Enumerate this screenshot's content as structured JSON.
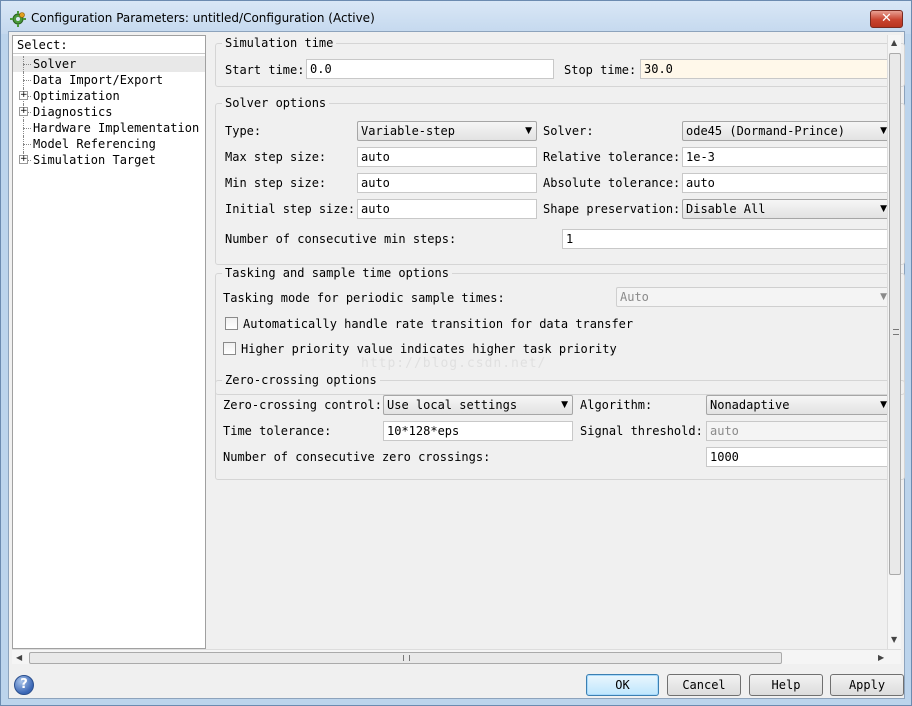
{
  "window": {
    "title": "Configuration Parameters: untitled/Configuration (Active)",
    "app_icon": "simulink-gear-icon",
    "close_glyph": "✕"
  },
  "tree": {
    "header": "Select:",
    "items": [
      {
        "label": "Solver",
        "expandable": false,
        "selected": true
      },
      {
        "label": "Data Import/Export",
        "expandable": false,
        "selected": false
      },
      {
        "label": "Optimization",
        "expandable": true,
        "selected": false
      },
      {
        "label": "Diagnostics",
        "expandable": true,
        "selected": false
      },
      {
        "label": "Hardware Implementation",
        "expandable": false,
        "selected": false
      },
      {
        "label": "Model Referencing",
        "expandable": false,
        "selected": false
      },
      {
        "label": "Simulation Target",
        "expandable": true,
        "selected": false
      }
    ]
  },
  "simulation_time": {
    "title": "Simulation time",
    "start_label": "Start time:",
    "start_value": "0.0",
    "stop_label": "Stop time:",
    "stop_value": "30.0"
  },
  "solver_options": {
    "title": "Solver options",
    "type_label": "Type:",
    "type_value": "Variable-step",
    "solver_label": "Solver:",
    "solver_value": "ode45 (Dormand-Prince)",
    "max_step_label": "Max step size:",
    "max_step_value": "auto",
    "rel_tol_label": "Relative tolerance:",
    "rel_tol_value": "1e-3",
    "min_step_label": "Min step size:",
    "min_step_value": "auto",
    "abs_tol_label": "Absolute tolerance:",
    "abs_tol_value": "auto",
    "init_step_label": "Initial step size:",
    "init_step_value": "auto",
    "shape_label": "Shape preservation:",
    "shape_value": "Disable All",
    "consec_min_label": "Number of consecutive min steps:",
    "consec_min_value": "1"
  },
  "tasking": {
    "title": "Tasking and sample time options",
    "mode_label": "Tasking mode for periodic sample times:",
    "mode_value": "Auto",
    "auto_rate_label": "Automatically handle rate transition for data transfer",
    "auto_rate_checked": false,
    "priority_label": "Higher priority value indicates higher task priority",
    "priority_checked": false
  },
  "zero_crossing": {
    "title": "Zero-crossing options",
    "control_label": "Zero-crossing control:",
    "control_value": "Use local settings",
    "algorithm_label": "Algorithm:",
    "algorithm_value": "Nonadaptive",
    "time_tol_label": "Time tolerance:",
    "time_tol_value": "10*128*eps",
    "signal_thr_label": "Signal threshold:",
    "signal_thr_value": "auto",
    "consec_zc_label": "Number of consecutive zero crossings:",
    "consec_zc_value": "1000"
  },
  "watermark": "http://blog.csdn.net/",
  "scroll": {
    "up_arrow": "▲",
    "down_arrow": "▼",
    "left_arrow": "◀",
    "right_arrow": "▶"
  },
  "buttons": {
    "help_glyph": "?",
    "ok": "OK",
    "cancel": "Cancel",
    "help": "Help",
    "apply": "Apply"
  },
  "colors": {
    "window_frame": "#bcd4ec",
    "dialog_bg": "#f0f0f0",
    "close_button": "#c9432f",
    "default_button": "#bee6fd"
  }
}
